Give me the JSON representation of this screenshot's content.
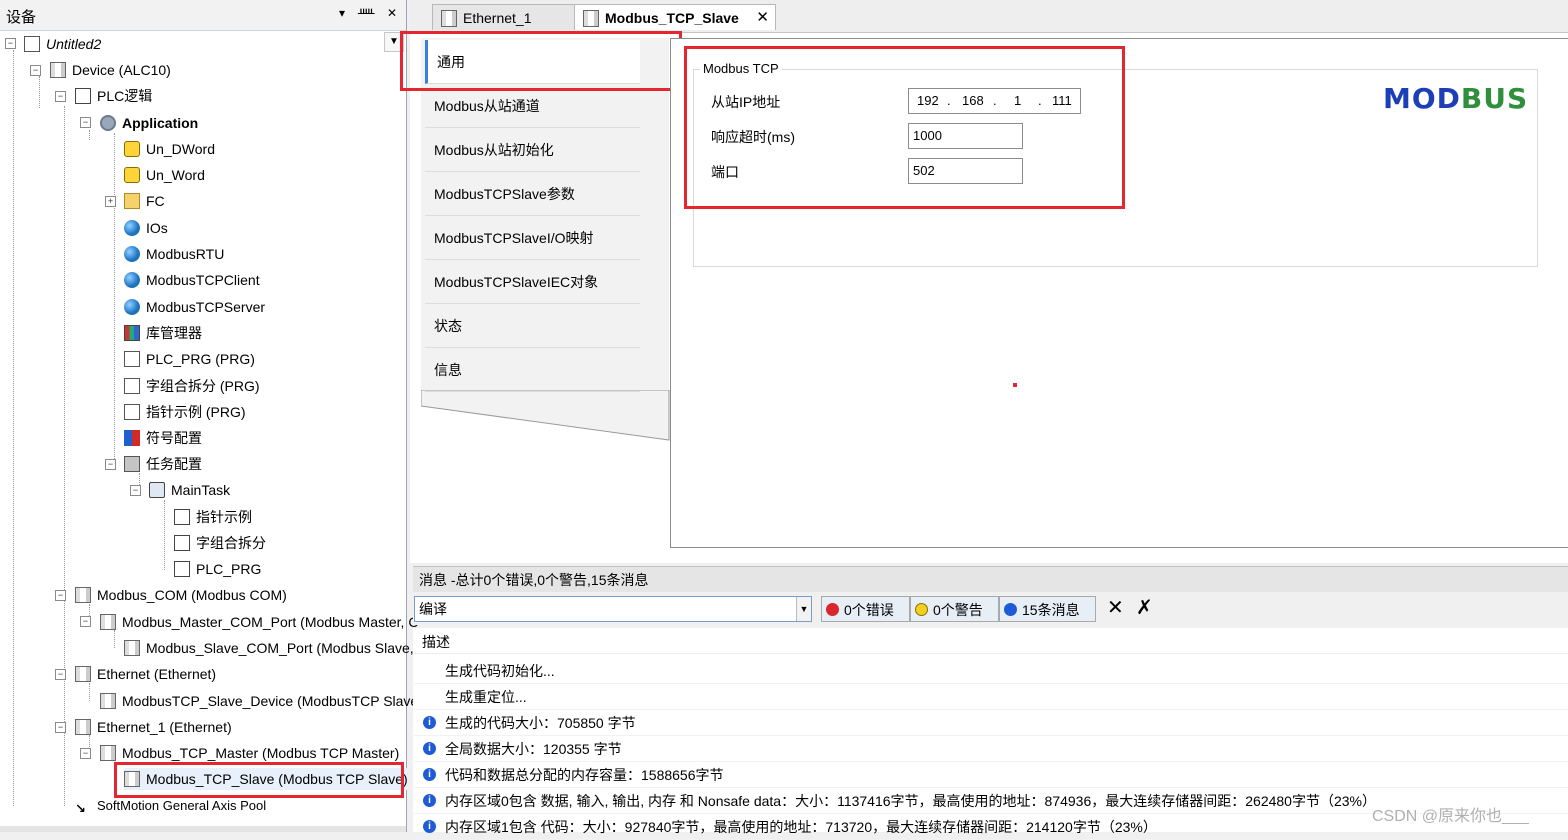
{
  "left_panel": {
    "title": "设备",
    "pin_label": "▾",
    "pushpin_label": "ᚊ",
    "close_label": "✕",
    "tree": [
      {
        "label": "Untitled2"
      },
      {
        "label": "Device (ALC10)"
      },
      {
        "label": "PLC逻辑"
      },
      {
        "label": "Application"
      },
      {
        "label": "Un_DWord"
      },
      {
        "label": "Un_Word"
      },
      {
        "label": "FC"
      },
      {
        "label": "IOs"
      },
      {
        "label": "ModbusRTU"
      },
      {
        "label": "ModbusTCPClient"
      },
      {
        "label": "ModbusTCPServer"
      },
      {
        "label": "库管理器"
      },
      {
        "label": "PLC_PRG (PRG)"
      },
      {
        "label": "字组合拆分 (PRG)"
      },
      {
        "label": "指针示例 (PRG)"
      },
      {
        "label": "符号配置"
      },
      {
        "label": "任务配置"
      },
      {
        "label": "MainTask"
      },
      {
        "label": "指针示例"
      },
      {
        "label": "字组合拆分"
      },
      {
        "label": "PLC_PRG"
      },
      {
        "label": "Modbus_COM (Modbus COM)"
      },
      {
        "label": "Modbus_Master_COM_Port (Modbus Master, C"
      },
      {
        "label": "Modbus_Slave_COM_Port (Modbus Slave,"
      },
      {
        "label": "Ethernet (Ethernet)"
      },
      {
        "label": "ModbusTCP_Slave_Device (ModbusTCP Slave D"
      },
      {
        "label": "Ethernet_1 (Ethernet)"
      },
      {
        "label": "Modbus_TCP_Master (Modbus TCP Master)"
      },
      {
        "label": "Modbus_TCP_Slave (Modbus TCP Slave)"
      },
      {
        "label": "SoftMotion General Axis Pool"
      }
    ]
  },
  "tabs": [
    {
      "label": "Ethernet_1"
    },
    {
      "label": "Modbus_TCP_Slave",
      "close": "✕"
    }
  ],
  "side_nav": [
    "通用",
    "Modbus从站通道",
    "Modbus从站初始化",
    "ModbusTCPSlave参数",
    "ModbusTCPSlaveI/O映射",
    "ModbusTCPSlaveIEC对象",
    "状态",
    "信息"
  ],
  "modbus_tcp": {
    "group_title": "Modbus TCP",
    "ip_label": "从站IP地址",
    "ip": [
      "192",
      "168",
      "1",
      "111"
    ],
    "timeout_label": "响应超时(ms)",
    "timeout": "1000",
    "port_label": "端口",
    "port": "502"
  },
  "logo": {
    "text_a": "MOD",
    "text_b": "BUS",
    "color_a": "#1c3fb8",
    "color_b": "#2f8f3a"
  },
  "messages": {
    "header": "消息 -总计0个错误,0个警告,15条消息",
    "category": "编译",
    "filters": {
      "errors": "0个错误",
      "warnings": "0个警告",
      "messages": "15条消息"
    },
    "column_title": "描述",
    "rows": [
      {
        "icon": false,
        "text": "生成代码初始化..."
      },
      {
        "icon": false,
        "text": "生成重定位..."
      },
      {
        "icon": true,
        "text": "生成的代码大小：705850 字节"
      },
      {
        "icon": true,
        "text": "全局数据大小：120355 字节"
      },
      {
        "icon": true,
        "text": "代码和数据总分配的内存容量：1588656字节"
      },
      {
        "icon": true,
        "text": "内存区域0包含 数据, 输入, 输出, 内存 和 Nonsafe data：大小：1137416字节，最高使用的地址：874936，最大连续存储器间距：262480字节（23%）"
      },
      {
        "icon": true,
        "text": "内存区域1包含 代码：大小：927840字节，最高使用的地址：713720，最大连续存储器间距：214120字节（23%）"
      }
    ]
  },
  "watermark": "CSDN @原来你也___",
  "colors": {
    "highlight_box": "#e3262f",
    "selection_accent": "#3a7fd8",
    "info_blue": "#1f5bd6"
  }
}
